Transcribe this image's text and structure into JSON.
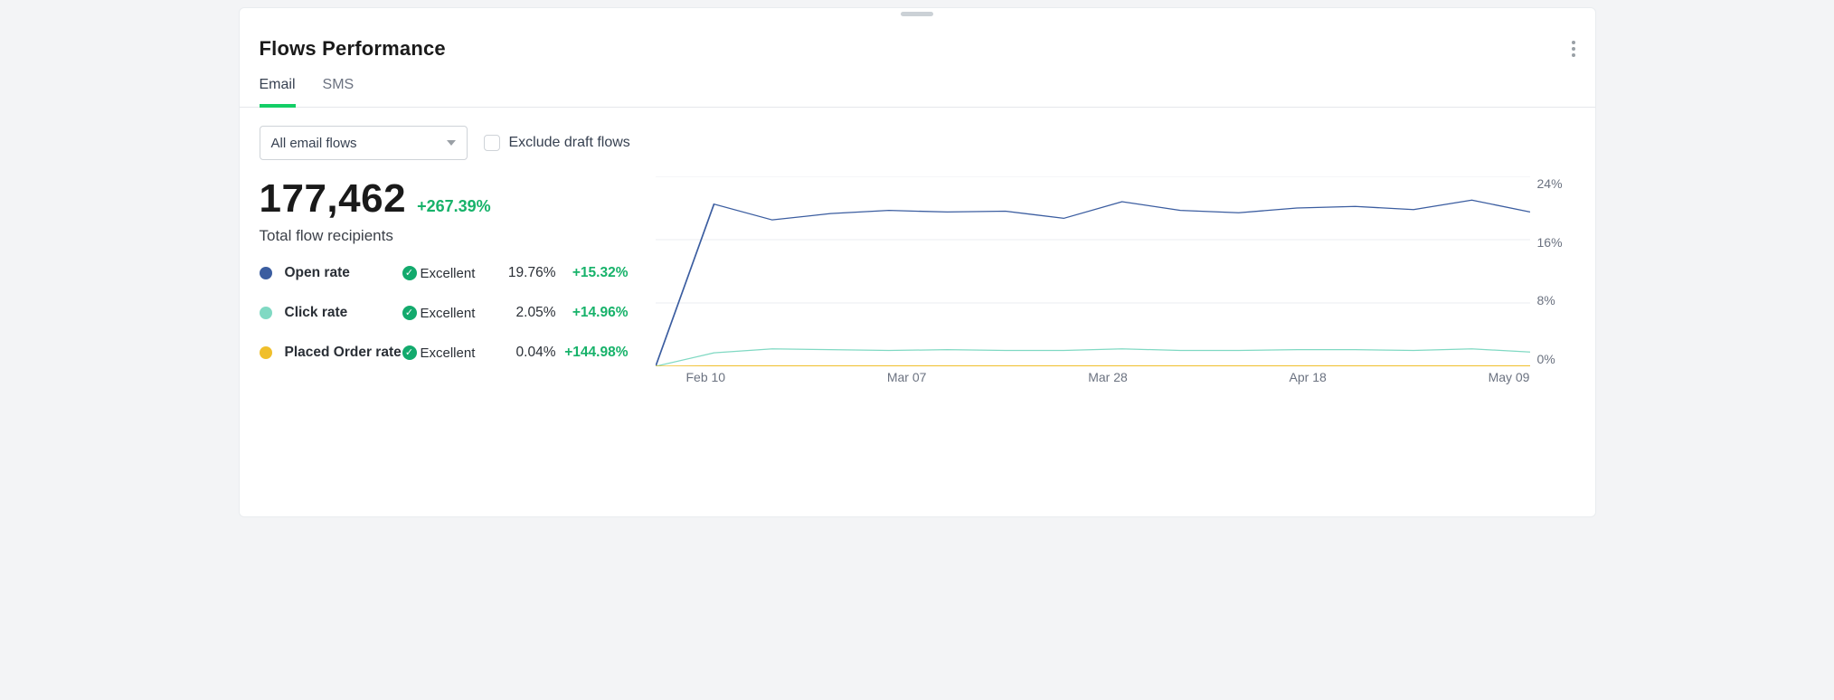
{
  "header": {
    "title": "Flows Performance"
  },
  "tabs": [
    {
      "label": "Email",
      "active": true
    },
    {
      "label": "SMS",
      "active": false
    }
  ],
  "controls": {
    "dropdown_selected": "All email flows",
    "exclude_label": "Exclude draft flows",
    "exclude_checked": false
  },
  "summary": {
    "total_value": "177,462",
    "total_delta": "+267.39%",
    "total_label": "Total flow recipients"
  },
  "metrics": [
    {
      "name": "Open rate",
      "rating": "Excellent",
      "value": "19.76%",
      "delta": "+15.32%",
      "color": "#3b5da0"
    },
    {
      "name": "Click rate",
      "rating": "Excellent",
      "value": "2.05%",
      "delta": "+14.96%",
      "color": "#80d9c3"
    },
    {
      "name": "Placed Order rate",
      "rating": "Excellent",
      "value": "0.04%",
      "delta": "+144.98%",
      "color": "#f0bf2b"
    }
  ],
  "chart_data": {
    "type": "line",
    "ylabel": "%",
    "ylim": [
      0,
      24
    ],
    "ytick_labels": [
      "24%",
      "16%",
      "8%",
      "0%"
    ],
    "x_labels": [
      "Feb 10",
      "Mar 07",
      "Mar 28",
      "Apr 18",
      "May 09"
    ],
    "x": [
      0,
      1,
      2,
      3,
      4,
      5,
      6,
      7,
      8,
      9,
      10,
      11,
      12,
      13,
      14,
      15
    ],
    "series": [
      {
        "name": "Open rate",
        "color": "#3b5da0",
        "values": [
          0,
          20.5,
          18.5,
          19.3,
          19.7,
          19.5,
          19.6,
          18.7,
          20.8,
          19.7,
          19.4,
          20.0,
          20.2,
          19.8,
          21.0,
          19.5
        ]
      },
      {
        "name": "Click rate",
        "color": "#80d9c3",
        "values": [
          0,
          1.7,
          2.2,
          2.1,
          2.0,
          2.1,
          2.0,
          2.0,
          2.2,
          2.0,
          2.0,
          2.1,
          2.1,
          2.0,
          2.2,
          1.8
        ]
      },
      {
        "name": "Placed Order rate",
        "color": "#f0bf2b",
        "values": [
          0,
          0.04,
          0.05,
          0.04,
          0.04,
          0.04,
          0.04,
          0.04,
          0.05,
          0.04,
          0.04,
          0.04,
          0.04,
          0.04,
          0.05,
          0.04
        ]
      }
    ]
  }
}
